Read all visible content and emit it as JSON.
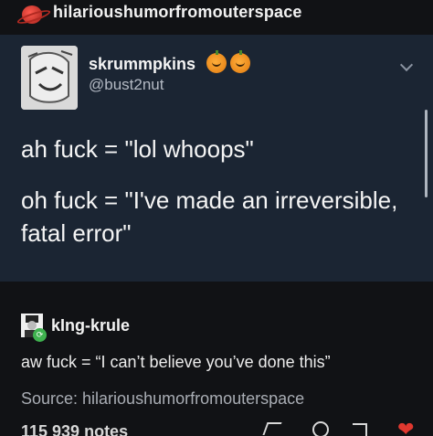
{
  "header": {
    "blog_name": "hilarioushumorfromouterspace"
  },
  "post": {
    "username": "skrummpkins",
    "handle": "@bust2nut",
    "line1": "ah fuck = \"lol whoops\"",
    "line2": "oh fuck = \"I've made an irreversible, fatal error\""
  },
  "reblog": {
    "username": "kIng-krule",
    "text": "aw fuck = “I can’t believe you’ve done this”",
    "source": "Source: hilarioushumorfromouterspace",
    "notes": "115 939 notes"
  },
  "icons": {
    "header": "planet-icon",
    "badge": "pumpkin-icon",
    "menu": "chevron-down-icon",
    "share": "share-icon",
    "reply": "reply-icon",
    "reblog": "reblog-icon",
    "like": "heart-icon"
  },
  "colors": {
    "post_bg": "#1b2533",
    "page_bg": "#111215",
    "like": "#e0382f",
    "reblog_badge": "#3fb24f"
  }
}
